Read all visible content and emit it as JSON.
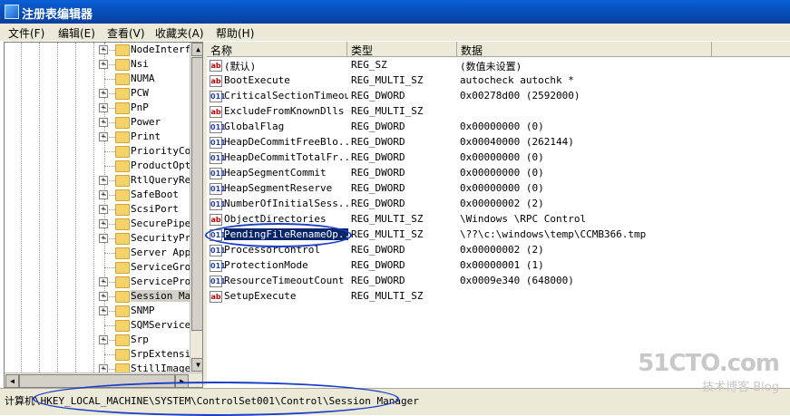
{
  "window": {
    "title": "注册表编辑器"
  },
  "menu": [
    "文件(F)",
    "编辑(E)",
    "查看(V)",
    "收藏夹(A)",
    "帮助(H)"
  ],
  "tree": {
    "items": [
      {
        "label": "NodeInterf",
        "expander": true
      },
      {
        "label": "Nsi",
        "expander": true
      },
      {
        "label": "NUMA",
        "expander": false
      },
      {
        "label": "PCW",
        "expander": true
      },
      {
        "label": "PnP",
        "expander": true
      },
      {
        "label": "Power",
        "expander": true
      },
      {
        "label": "Print",
        "expander": true
      },
      {
        "label": "PriorityCo",
        "expander": false
      },
      {
        "label": "ProductOpt",
        "expander": false
      },
      {
        "label": "RtlQueryRe",
        "expander": true
      },
      {
        "label": "SafeBoot",
        "expander": true
      },
      {
        "label": "ScsiPort",
        "expander": true
      },
      {
        "label": "SecurePipe",
        "expander": true
      },
      {
        "label": "SecurityPr",
        "expander": true
      },
      {
        "label": "Server App",
        "expander": false
      },
      {
        "label": "ServiceGro",
        "expander": false
      },
      {
        "label": "ServicePro",
        "expander": true
      },
      {
        "label": "Session Ma",
        "expander": true,
        "selected": true
      },
      {
        "label": "SNMP",
        "expander": true
      },
      {
        "label": "SQMService",
        "expander": false
      },
      {
        "label": "Srp",
        "expander": true
      },
      {
        "label": "SrpExtensi",
        "expander": false
      },
      {
        "label": "StillImage",
        "expander": true
      }
    ]
  },
  "columns": {
    "name": "名称",
    "type": "类型",
    "data": "数据"
  },
  "values": [
    {
      "icon": "ab",
      "name": "(默认)",
      "type": "REG_SZ",
      "data": "(数值未设置)"
    },
    {
      "icon": "ab",
      "name": "BootExecute",
      "type": "REG_MULTI_SZ",
      "data": "autocheck autochk *"
    },
    {
      "icon": "bin",
      "name": "CriticalSectionTimeout",
      "type": "REG_DWORD",
      "data": "0x00278d00 (2592000)"
    },
    {
      "icon": "ab",
      "name": "ExcludeFromKnownDlls",
      "type": "REG_MULTI_SZ",
      "data": ""
    },
    {
      "icon": "bin",
      "name": "GlobalFlag",
      "type": "REG_DWORD",
      "data": "0x00000000 (0)"
    },
    {
      "icon": "bin",
      "name": "HeapDeCommitFreeBlo...",
      "type": "REG_DWORD",
      "data": "0x00040000 (262144)"
    },
    {
      "icon": "bin",
      "name": "HeapDeCommitTotalFr...",
      "type": "REG_DWORD",
      "data": "0x00000000 (0)"
    },
    {
      "icon": "bin",
      "name": "HeapSegmentCommit",
      "type": "REG_DWORD",
      "data": "0x00000000 (0)"
    },
    {
      "icon": "bin",
      "name": "HeapSegmentReserve",
      "type": "REG_DWORD",
      "data": "0x00000000 (0)"
    },
    {
      "icon": "bin",
      "name": "NumberOfInitialSess...",
      "type": "REG_DWORD",
      "data": "0x00000002 (2)"
    },
    {
      "icon": "ab",
      "name": "ObjectDirectories",
      "type": "REG_MULTI_SZ",
      "data": "\\Windows \\RPC Control"
    },
    {
      "icon": "bin",
      "name": "PendingFileRenameOp...",
      "type": "REG_MULTI_SZ",
      "data": "\\??\\c:\\windows\\temp\\CCMB366.tmp",
      "selected": true
    },
    {
      "icon": "bin",
      "name": "ProcessorControl",
      "type": "REG_DWORD",
      "data": "0x00000002 (2)"
    },
    {
      "icon": "bin",
      "name": "ProtectionMode",
      "type": "REG_DWORD",
      "data": "0x00000001 (1)"
    },
    {
      "icon": "bin",
      "name": "ResourceTimeoutCount",
      "type": "REG_DWORD",
      "data": "0x0009e340 (648000)"
    },
    {
      "icon": "ab",
      "name": "SetupExecute",
      "type": "REG_MULTI_SZ",
      "data": ""
    }
  ],
  "status": "计算机\\HKEY_LOCAL_MACHINE\\SYSTEM\\ControlSet001\\Control\\Session Manager",
  "watermark": {
    "logo": "51CTO.com",
    "tagline": "技术博客",
    "blog": "Blog"
  },
  "colors": {
    "title_bar": "#0a5fd8",
    "chrome": "#ece9d8",
    "selection": "#0a246a",
    "annotation": "#1a3ec8"
  }
}
